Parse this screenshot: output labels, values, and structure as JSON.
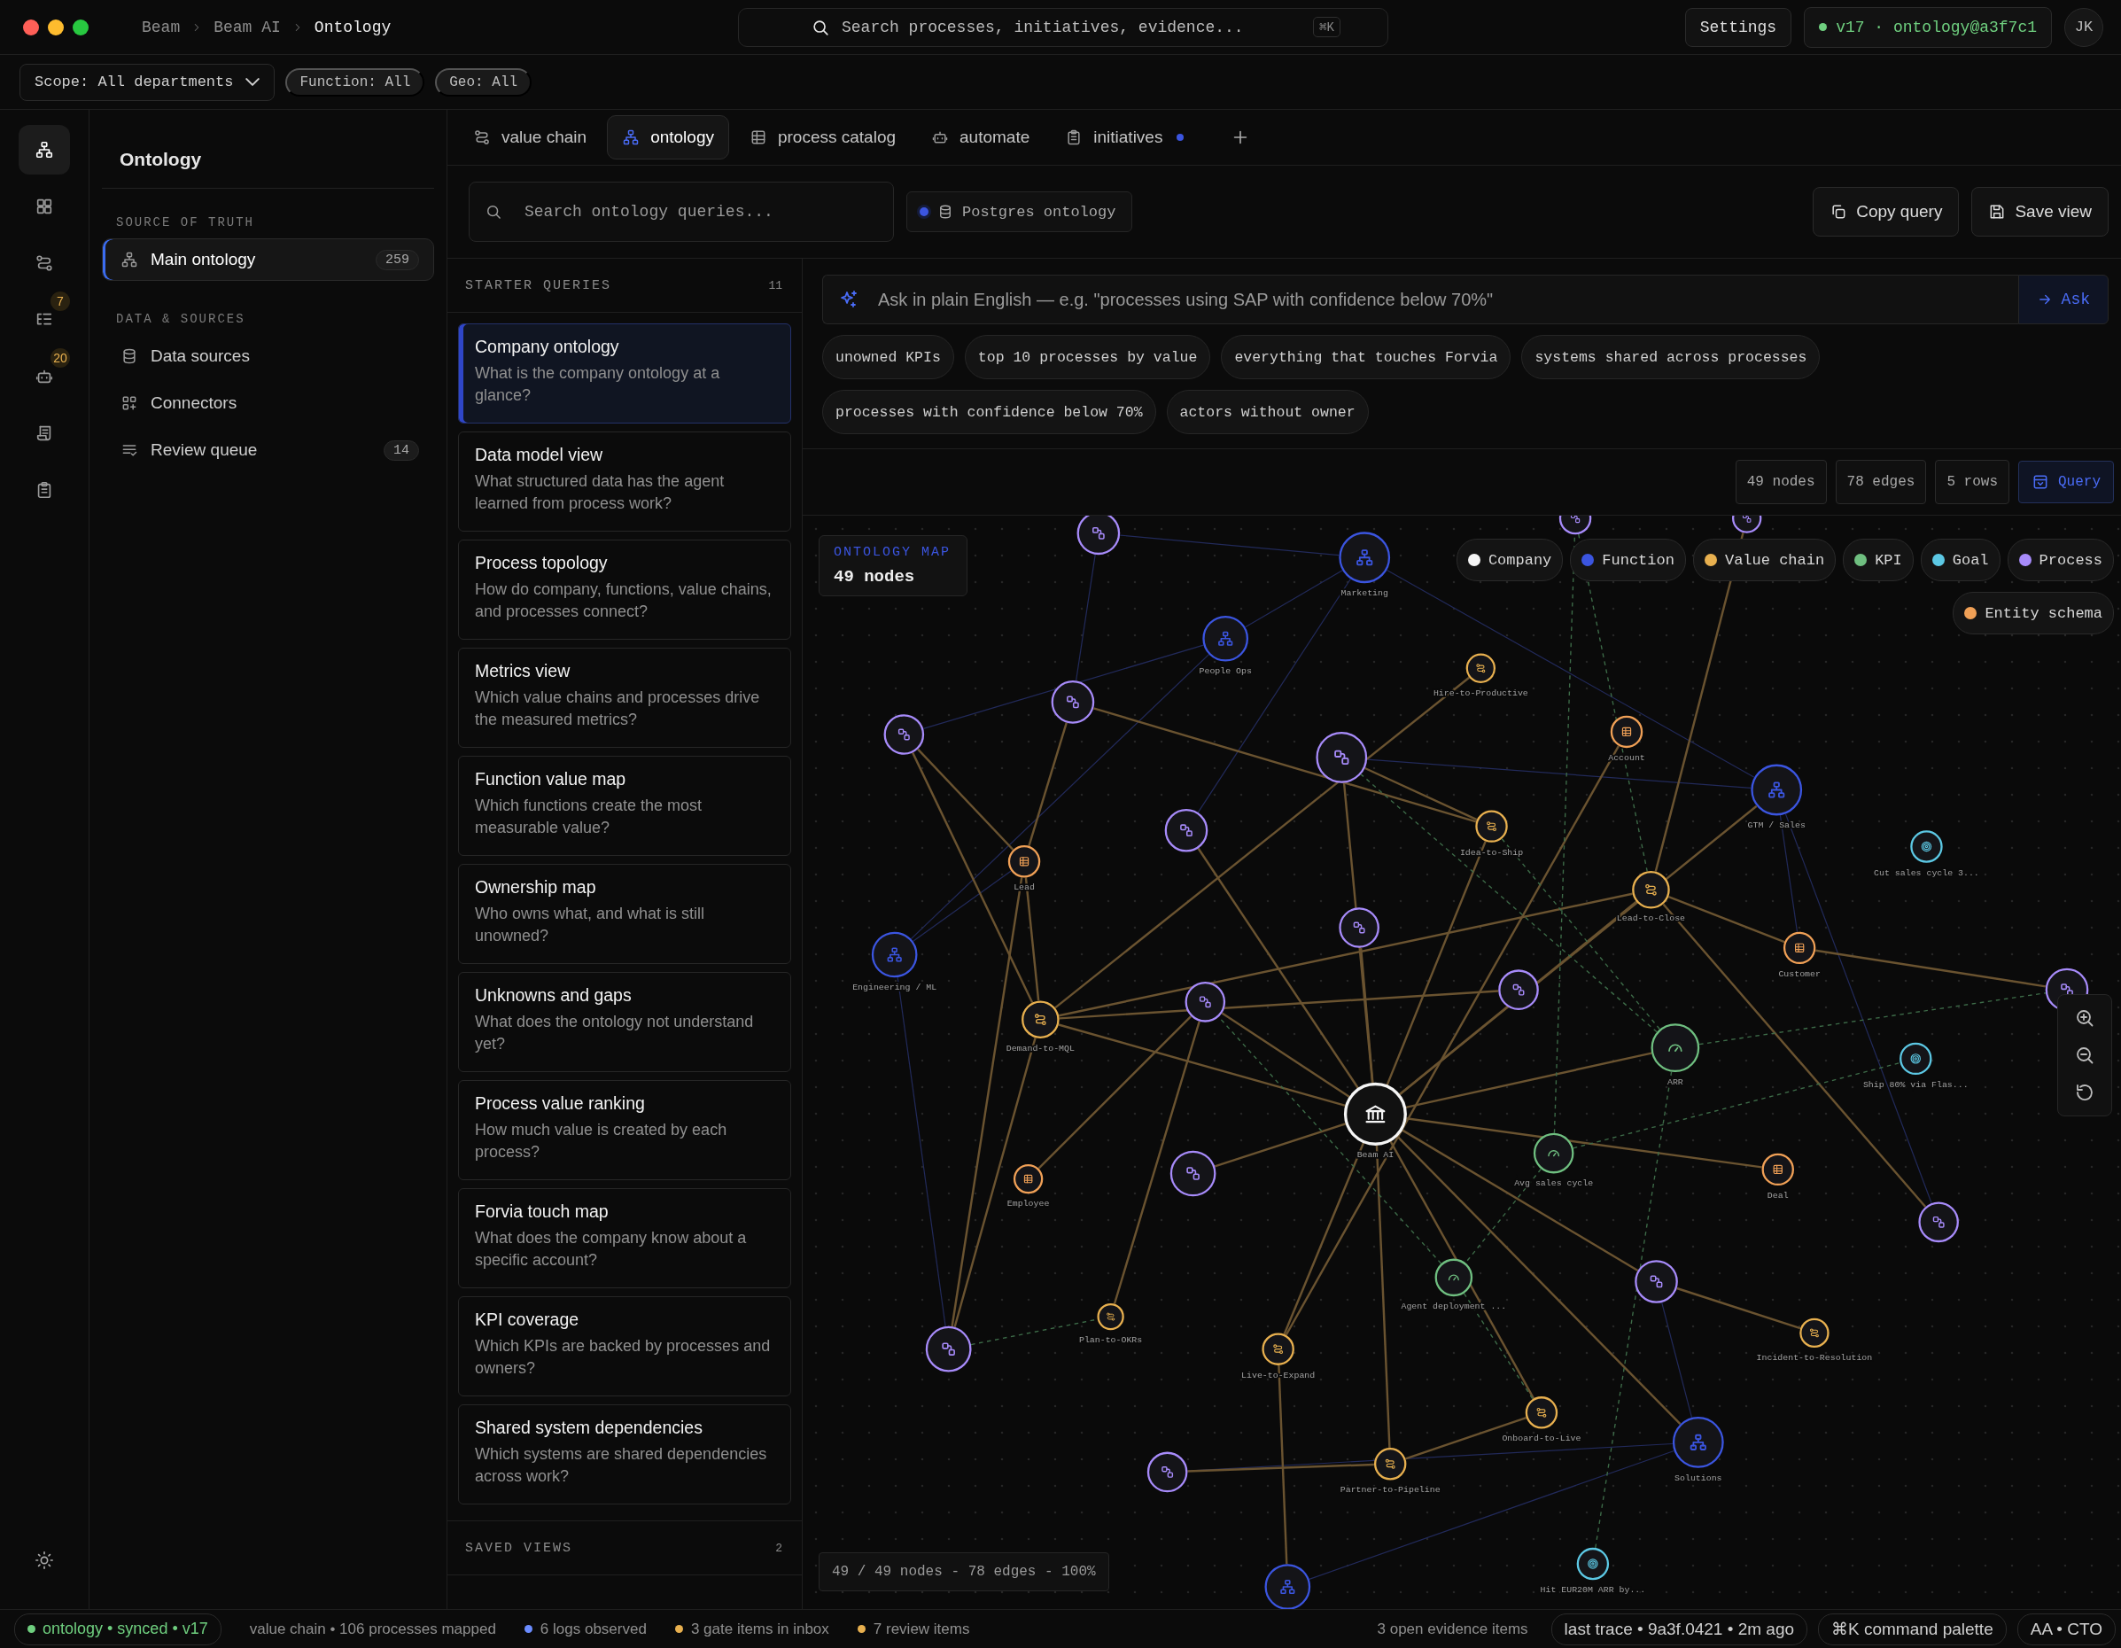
{
  "window": {
    "breadcrumbs": [
      "Beam",
      "Beam AI",
      "Ontology"
    ]
  },
  "search": {
    "placeholder": "Search processes, initiatives, evidence...",
    "shortcut": "⌘K"
  },
  "settings_button": "Settings",
  "version": {
    "label": "v17 · ontology@a3f7c1"
  },
  "avatar": "JK",
  "filters": [
    {
      "label": "Scope: All departments",
      "kind": "dropdown"
    },
    {
      "label": "Function: All",
      "kind": "chip"
    },
    {
      "label": "Geo: All",
      "kind": "chip"
    }
  ],
  "rail": [
    {
      "kind": "ontology",
      "selected": true
    },
    {
      "kind": "dashboard",
      "selected": false
    },
    {
      "kind": "value_chain",
      "selected": false
    },
    {
      "kind": "tasks",
      "selected": false,
      "badge": "7"
    },
    {
      "kind": "agents",
      "selected": false,
      "badge": "20"
    },
    {
      "kind": "logs",
      "selected": false
    },
    {
      "kind": "initiatives",
      "selected": false
    }
  ],
  "nav": {
    "title": "Ontology",
    "sections": [
      {
        "heading": "SOURCE OF TRUTH",
        "items": [
          {
            "label": "Main ontology",
            "count": "259",
            "kind": "ontology",
            "selected": true
          }
        ]
      },
      {
        "heading": "DATA & SOURCES",
        "items": [
          {
            "label": "Data sources",
            "kind": "database",
            "selected": false
          },
          {
            "label": "Connectors",
            "kind": "connectors",
            "selected": false
          },
          {
            "label": "Review queue",
            "count": "14",
            "kind": "queue",
            "selected": false
          }
        ]
      }
    ]
  },
  "tabs": [
    {
      "label": "value chain",
      "kind": "value_chain",
      "selected": false,
      "unread": false
    },
    {
      "label": "ontology",
      "kind": "ontology",
      "selected": true,
      "unread": false
    },
    {
      "label": "process catalog",
      "kind": "table",
      "selected": false,
      "unread": false
    },
    {
      "label": "automate",
      "kind": "agents",
      "selected": false,
      "unread": false
    },
    {
      "label": "initiatives",
      "kind": "initiatives",
      "selected": false,
      "unread": true
    }
  ],
  "query_search": {
    "placeholder": "Search ontology queries..."
  },
  "source_chip": {
    "label": "Postgres ontology"
  },
  "actions": [
    {
      "label": "Copy query",
      "kind": "copy"
    },
    {
      "label": "Save view",
      "kind": "save"
    }
  ],
  "starter_queries": {
    "heading": "STARTER QUERIES",
    "count": "11",
    "items": [
      {
        "title": "Company ontology",
        "question": "What is the company ontology at a glance?",
        "selected": true
      },
      {
        "title": "Data model view",
        "question": "What structured data has the agent learned from process work?",
        "selected": false
      },
      {
        "title": "Process topology",
        "question": "How do company, functions, value chains, and processes connect?",
        "selected": false
      },
      {
        "title": "Metrics view",
        "question": "Which value chains and processes drive the measured metrics?",
        "selected": false
      },
      {
        "title": "Function value map",
        "question": "Which functions create the most measurable value?",
        "selected": false
      },
      {
        "title": "Ownership map",
        "question": "Who owns what, and what is still unowned?",
        "selected": false
      },
      {
        "title": "Unknowns and gaps",
        "question": "What does the ontology not understand yet?",
        "selected": false
      },
      {
        "title": "Process value ranking",
        "question": "How much value is created by each process?",
        "selected": false
      },
      {
        "title": "Forvia touch map",
        "question": "What does the company know about a specific account?",
        "selected": false
      },
      {
        "title": "KPI coverage",
        "question": "Which KPIs are backed by processes and owners?",
        "selected": false
      },
      {
        "title": "Shared system dependencies",
        "question": "Which systems are shared dependencies across work?",
        "selected": false
      }
    ]
  },
  "saved_views": {
    "heading": "SAVED VIEWS",
    "count": "2"
  },
  "ask": {
    "placeholder": "Ask in plain English — e.g. \"processes using SAP with confidence below 70%\"",
    "button": "Ask"
  },
  "suggestions": [
    "unowned KPIs",
    "top 10 processes by value",
    "everything that touches Forvia",
    "systems shared across processes",
    "processes with confidence below 70%",
    "actors without owner"
  ],
  "stats": [
    "49 nodes",
    "78 edges",
    "5 rows"
  ],
  "query_button": "Query",
  "map": {
    "title": "ONTOLOGY MAP",
    "subtitle": "49 nodes",
    "legend": [
      {
        "label": "Company",
        "kind": "company",
        "color": "#f5f5f5"
      },
      {
        "label": "Function",
        "kind": "function",
        "color": "#3b55e0"
      },
      {
        "label": "Value chain",
        "kind": "value_chain",
        "color": "#e8b04f"
      },
      {
        "label": "KPI",
        "kind": "kpi",
        "color": "#6fbf80"
      },
      {
        "label": "Goal",
        "kind": "goal",
        "color": "#5cc8e4"
      },
      {
        "label": "Process",
        "kind": "process",
        "color": "#a78bfa"
      },
      {
        "label": "Entity schema",
        "kind": "entity",
        "color": "#f0a056"
      }
    ],
    "nodes": [
      {
        "kind": "process"
      },
      {
        "kind": "process"
      },
      {
        "kind": "process"
      },
      {
        "kind": "function",
        "label": "Marketing"
      },
      {
        "kind": "function",
        "label": "People Ops"
      },
      {
        "kind": "value_chain",
        "label": "Hire-to-Productive"
      },
      {
        "kind": "process"
      },
      {
        "kind": "process"
      },
      {
        "kind": "process"
      },
      {
        "kind": "entity",
        "label": "Account"
      },
      {
        "kind": "function",
        "label": "GTM / Sales"
      },
      {
        "kind": "goal",
        "label": "Cut sales cycle 3..."
      },
      {
        "kind": "process"
      },
      {
        "kind": "entity",
        "label": "Lead"
      },
      {
        "kind": "value_chain",
        "label": "Idea-to-Ship"
      },
      {
        "kind": "value_chain",
        "label": "Lead-to-Close"
      },
      {
        "kind": "function",
        "label": "Engineering / ML"
      },
      {
        "kind": "process"
      },
      {
        "kind": "entity",
        "label": "Customer"
      },
      {
        "kind": "process"
      },
      {
        "kind": "value_chain",
        "label": "Demand-to-MQL"
      },
      {
        "kind": "process"
      },
      {
        "kind": "process"
      },
      {
        "kind": "kpi",
        "label": "ARR"
      },
      {
        "kind": "goal",
        "label": "Ship 80% via Flas..."
      },
      {
        "kind": "company",
        "label": "Beam AI"
      },
      {
        "kind": "kpi",
        "label": "Avg sales cycle"
      },
      {
        "kind": "entity",
        "label": "Employee"
      },
      {
        "kind": "process"
      },
      {
        "kind": "entity",
        "label": "Deal"
      },
      {
        "kind": "process"
      },
      {
        "kind": "kpi",
        "label": "Agent deployment ..."
      },
      {
        "kind": "process"
      },
      {
        "kind": "value_chain",
        "label": "Plan-to-OKRs"
      },
      {
        "kind": "value_chain",
        "label": "Live-to-Expand"
      },
      {
        "kind": "process"
      },
      {
        "kind": "value_chain",
        "label": "Incident-to-Resolution"
      },
      {
        "kind": "value_chain",
        "label": "Onboard-to-Live"
      },
      {
        "kind": "function",
        "label": "Solutions"
      },
      {
        "kind": "process"
      },
      {
        "kind": "value_chain",
        "label": "Partner-to-Pipeline"
      },
      {
        "kind": "goal",
        "label": "Hit EUR20M ARR by..."
      },
      {
        "kind": "function"
      }
    ],
    "footer": "49 / 49 nodes - 78 edges - 100%"
  },
  "status_bar": {
    "sync": "ontology • synced • v17",
    "items": [
      {
        "label": "value chain • 106 processes mapped"
      },
      {
        "label": "6 logs observed",
        "color": "#6b8cff"
      },
      {
        "label": "3 gate items in inbox",
        "color": "#e8b04f"
      },
      {
        "label": "7 review items",
        "color": "#e8b04f"
      }
    ],
    "evidence": "3 open evidence items",
    "pills": [
      "last trace • 9a3f.0421 • 2m ago",
      "⌘K command palette",
      "AA • CTO"
    ]
  }
}
